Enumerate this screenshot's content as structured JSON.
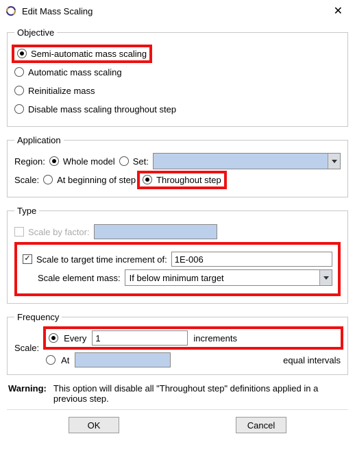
{
  "window": {
    "title": "Edit Mass Scaling"
  },
  "objective": {
    "legend": "Objective",
    "opt_semi": "Semi-automatic mass scaling",
    "opt_auto": "Automatic mass scaling",
    "opt_reinit": "Reinitialize mass",
    "opt_disable": "Disable mass scaling throughout step"
  },
  "application": {
    "legend": "Application",
    "region_label": "Region:",
    "region_whole": "Whole model",
    "region_set": "Set:",
    "scale_label": "Scale:",
    "scale_begin": "At beginning of step",
    "scale_through": "Throughout step"
  },
  "type": {
    "legend": "Type",
    "by_factor": "Scale by factor:",
    "to_target": "Scale to target time increment of:",
    "target_val": "1E-006",
    "elem_label": "Scale element mass:",
    "elem_sel": "If below minimum target"
  },
  "frequency": {
    "legend": "Frequency",
    "scale_label": "Scale:",
    "every": "Every",
    "every_val": "1",
    "every_unit": "increments",
    "at": "At",
    "at_unit": "equal intervals"
  },
  "warning": {
    "label": "Warning:",
    "text": "This option will disable all \"Throughout step\" definitions applied in a previous step."
  },
  "buttons": {
    "ok": "OK",
    "cancel": "Cancel"
  }
}
